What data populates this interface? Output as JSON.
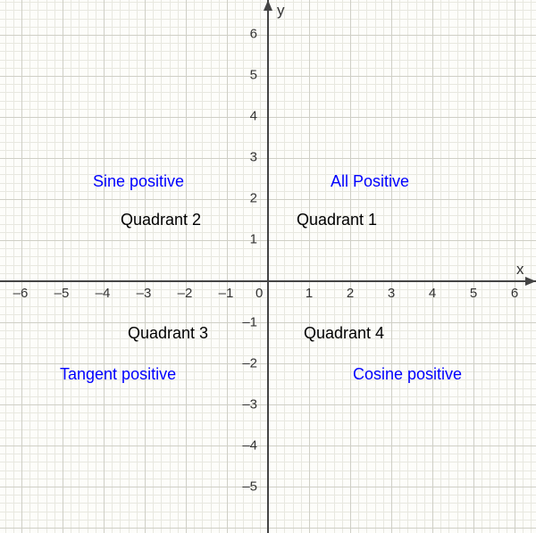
{
  "chart_data": {
    "type": "line",
    "title": "",
    "xlabel": "x",
    "ylabel": "y",
    "xlim": [
      -6,
      6
    ],
    "ylim": [
      -5.7,
      6.4
    ],
    "x_ticks": [
      -6,
      -5,
      -4,
      -3,
      -2,
      -1,
      0,
      1,
      2,
      3,
      4,
      5,
      6
    ],
    "y_ticks": [
      -5,
      -4,
      -3,
      -2,
      -1,
      1,
      2,
      3,
      4,
      5,
      6
    ],
    "series": [],
    "annotations": {
      "quadrants": [
        {
          "name": "Quadrant 1",
          "trig": "All Positive",
          "x": 2,
          "y": 1.5
        },
        {
          "name": "Quadrant 2",
          "trig": "Sine positive",
          "x": -2,
          "y": 1.5
        },
        {
          "name": "Quadrant 3",
          "trig": "Tangent positive",
          "x": -2,
          "y": -1.3
        },
        {
          "name": "Quadrant 4",
          "trig": "Cosine positive",
          "x": 2,
          "y": -1.3
        }
      ]
    }
  },
  "labels": {
    "q1": "Quadrant 1",
    "q2": "Quadrant 2",
    "q3": "Quadrant 3",
    "q4": "Quadrant 4",
    "t1": "All Positive",
    "t2": "Sine positive",
    "t3": "Tangent positive",
    "t4": "Cosine positive",
    "xaxis": "x",
    "yaxis": "y"
  },
  "ticks": {
    "x": {
      "n6": "–6",
      "n5": "–5",
      "n4": "–4",
      "n3": "–3",
      "n2": "–2",
      "n1": "–1",
      "zero": "0",
      "p1": "1",
      "p2": "2",
      "p3": "3",
      "p4": "4",
      "p5": "5",
      "p6": "6"
    },
    "y": {
      "n5": "–5",
      "n4": "–4",
      "n3": "–3",
      "n2": "–2",
      "n1": "–1",
      "p1": "1",
      "p2": "2",
      "p3": "3",
      "p4": "4",
      "p5": "5",
      "p6": "6"
    }
  }
}
